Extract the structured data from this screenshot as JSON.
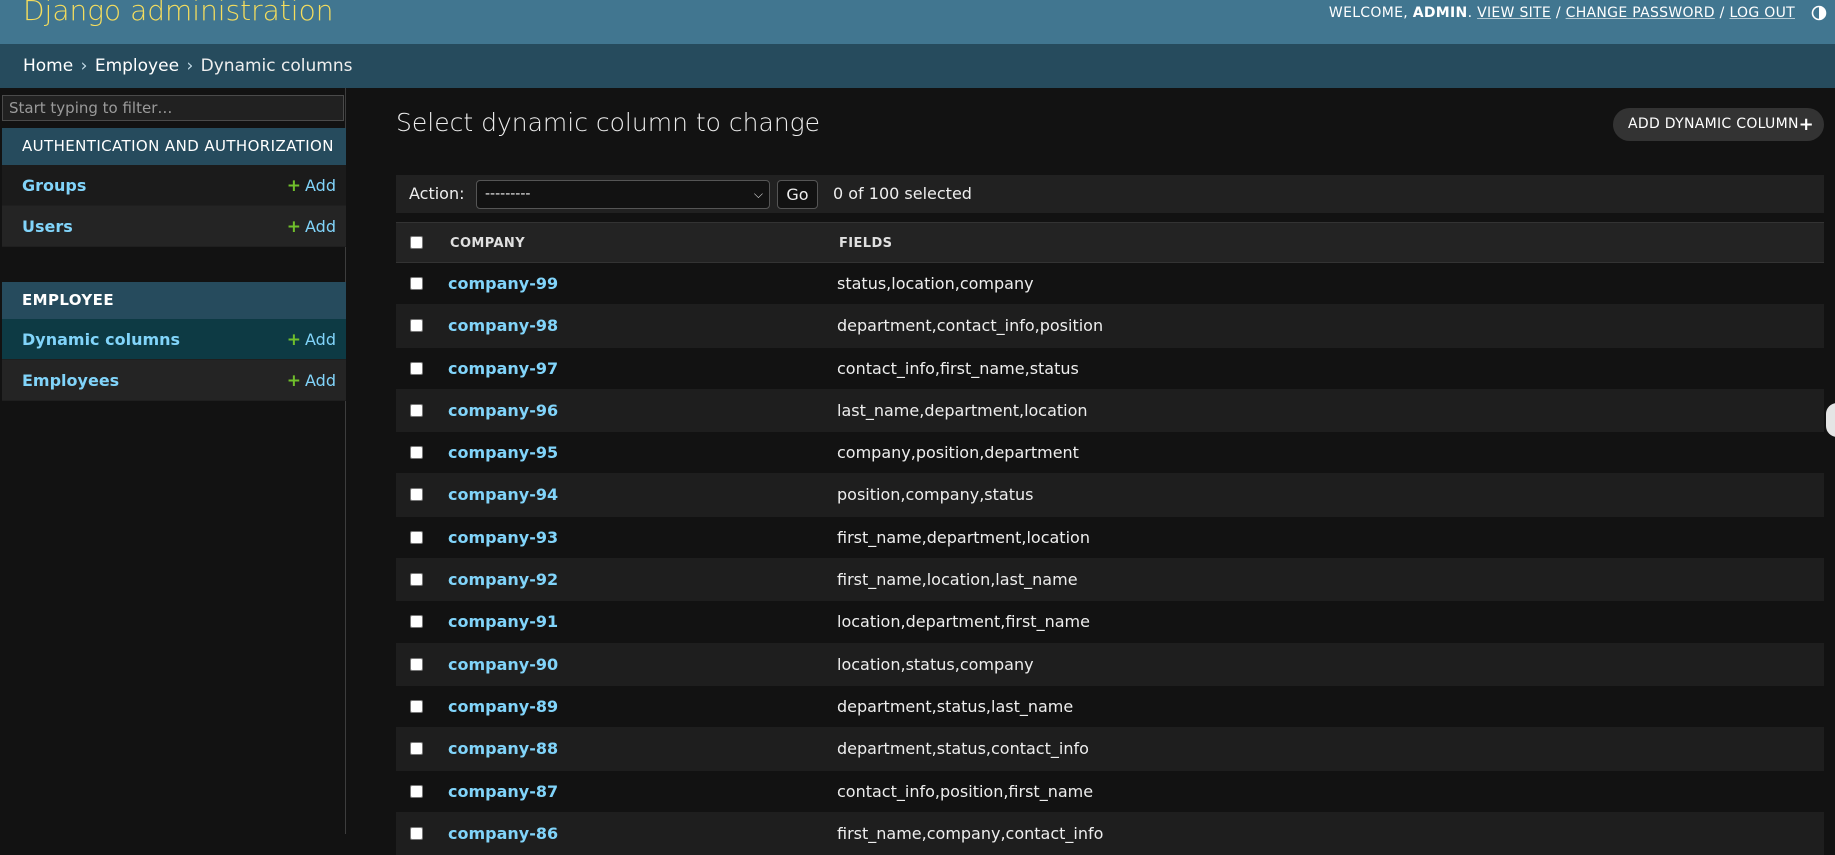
{
  "header": {
    "site_name": "Django administration",
    "welcome": "WELCOME,",
    "username": "ADMIN",
    "view_site": "VIEW SITE",
    "change_password": "CHANGE PASSWORD",
    "log_out": "LOG OUT",
    "sep": "/",
    "theme_icon": "half-circle-icon"
  },
  "breadcrumbs": {
    "items": [
      "Home",
      "Employee",
      "Dynamic columns"
    ],
    "separator": "›"
  },
  "sidebar": {
    "filter_placeholder": "Start typing to filter…",
    "apps": [
      {
        "caption": "AUTHENTICATION AND AUTHORIZATION",
        "models": [
          {
            "name": "Groups",
            "add": "Add"
          },
          {
            "name": "Users",
            "add": "Add"
          }
        ]
      },
      {
        "caption": "EMPLOYEE",
        "models": [
          {
            "name": "Dynamic columns",
            "add": "Add",
            "current": true
          },
          {
            "name": "Employees",
            "add": "Add"
          }
        ]
      }
    ]
  },
  "content": {
    "title": "Select dynamic column to change",
    "add_button": "ADD DYNAMIC COLUMN",
    "action_label": "Action:",
    "action_selected": "---------",
    "go": "Go",
    "selection_count": "0 of 100 selected",
    "columns": [
      "COMPANY",
      "FIELDS"
    ],
    "rows": [
      {
        "company": "company-99",
        "fields": "status,location,company"
      },
      {
        "company": "company-98",
        "fields": "department,contact_info,position"
      },
      {
        "company": "company-97",
        "fields": "contact_info,first_name,status"
      },
      {
        "company": "company-96",
        "fields": "last_name,department,location"
      },
      {
        "company": "company-95",
        "fields": "company,position,department"
      },
      {
        "company": "company-94",
        "fields": "position,company,status"
      },
      {
        "company": "company-93",
        "fields": "first_name,department,location"
      },
      {
        "company": "company-92",
        "fields": "first_name,location,last_name"
      },
      {
        "company": "company-91",
        "fields": "location,department,first_name"
      },
      {
        "company": "company-90",
        "fields": "location,status,company"
      },
      {
        "company": "company-89",
        "fields": "department,status,last_name"
      },
      {
        "company": "company-88",
        "fields": "department,status,contact_info"
      },
      {
        "company": "company-87",
        "fields": "contact_info,position,first_name"
      },
      {
        "company": "company-86",
        "fields": "first_name,company,contact_info"
      }
    ]
  },
  "colors": {
    "header_bg": "#417690",
    "breadcrumb_bg": "#264b5d",
    "brand_yellow": "#f5dd5d",
    "link_blue": "#81d4fa",
    "add_green": "#70bf2b",
    "page_bg": "#121212"
  }
}
